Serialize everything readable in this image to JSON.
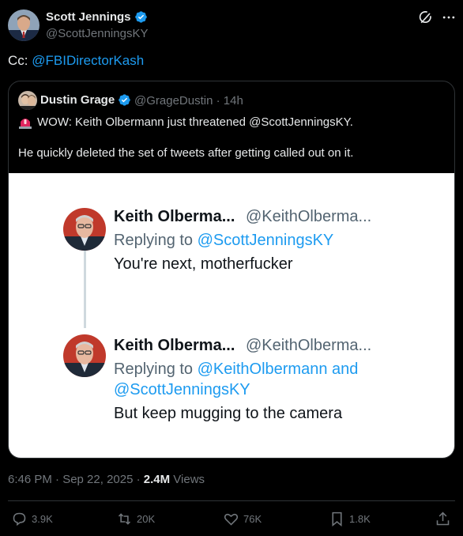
{
  "tweet": {
    "author_name": "Scott Jennings",
    "author_handle": "@ScottJenningsKY",
    "text_prefix": "Cc: ",
    "text_mention": "@FBIDirectorKash",
    "timestamp": "6:46 PM · Sep 22, 2025 · ",
    "views_count": "2.4M",
    "views_label": " Views"
  },
  "quote": {
    "author_name": "Dustin Grage",
    "author_handle_time": "@GrageDustin · 14h",
    "line1": "WOW: Keith Olbermann just threatened @ScottJenningsKY.",
    "line2": "He quickly deleted the set of tweets after getting called out on it."
  },
  "media": {
    "tweet1": {
      "name": "Keith Olberma...",
      "handle": "@KeithOlberma...",
      "reply_prefix": "Replying to ",
      "reply_to": "@ScottJenningsKY",
      "text": "You're next, motherfucker"
    },
    "tweet2": {
      "name": "Keith Olberma...",
      "handle": "@KeithOlberma...",
      "reply_prefix": "Replying to ",
      "reply_to_a": "@KeithOlbermann and",
      "reply_to_b": "@ScottJenningsKY",
      "text": "But keep mugging to the camera"
    }
  },
  "actions": {
    "replies": "3.9K",
    "reposts": "20K",
    "likes": "76K",
    "bookmarks": "1.8K"
  },
  "colors": {
    "accent": "#1d9bf0",
    "background": "#000000",
    "muted": "#71767b"
  },
  "icons": [
    "verified-badge-icon",
    "grok-icon",
    "more-icon",
    "siren-icon",
    "reply-icon",
    "repost-icon",
    "like-icon",
    "bookmark-icon",
    "share-icon"
  ]
}
